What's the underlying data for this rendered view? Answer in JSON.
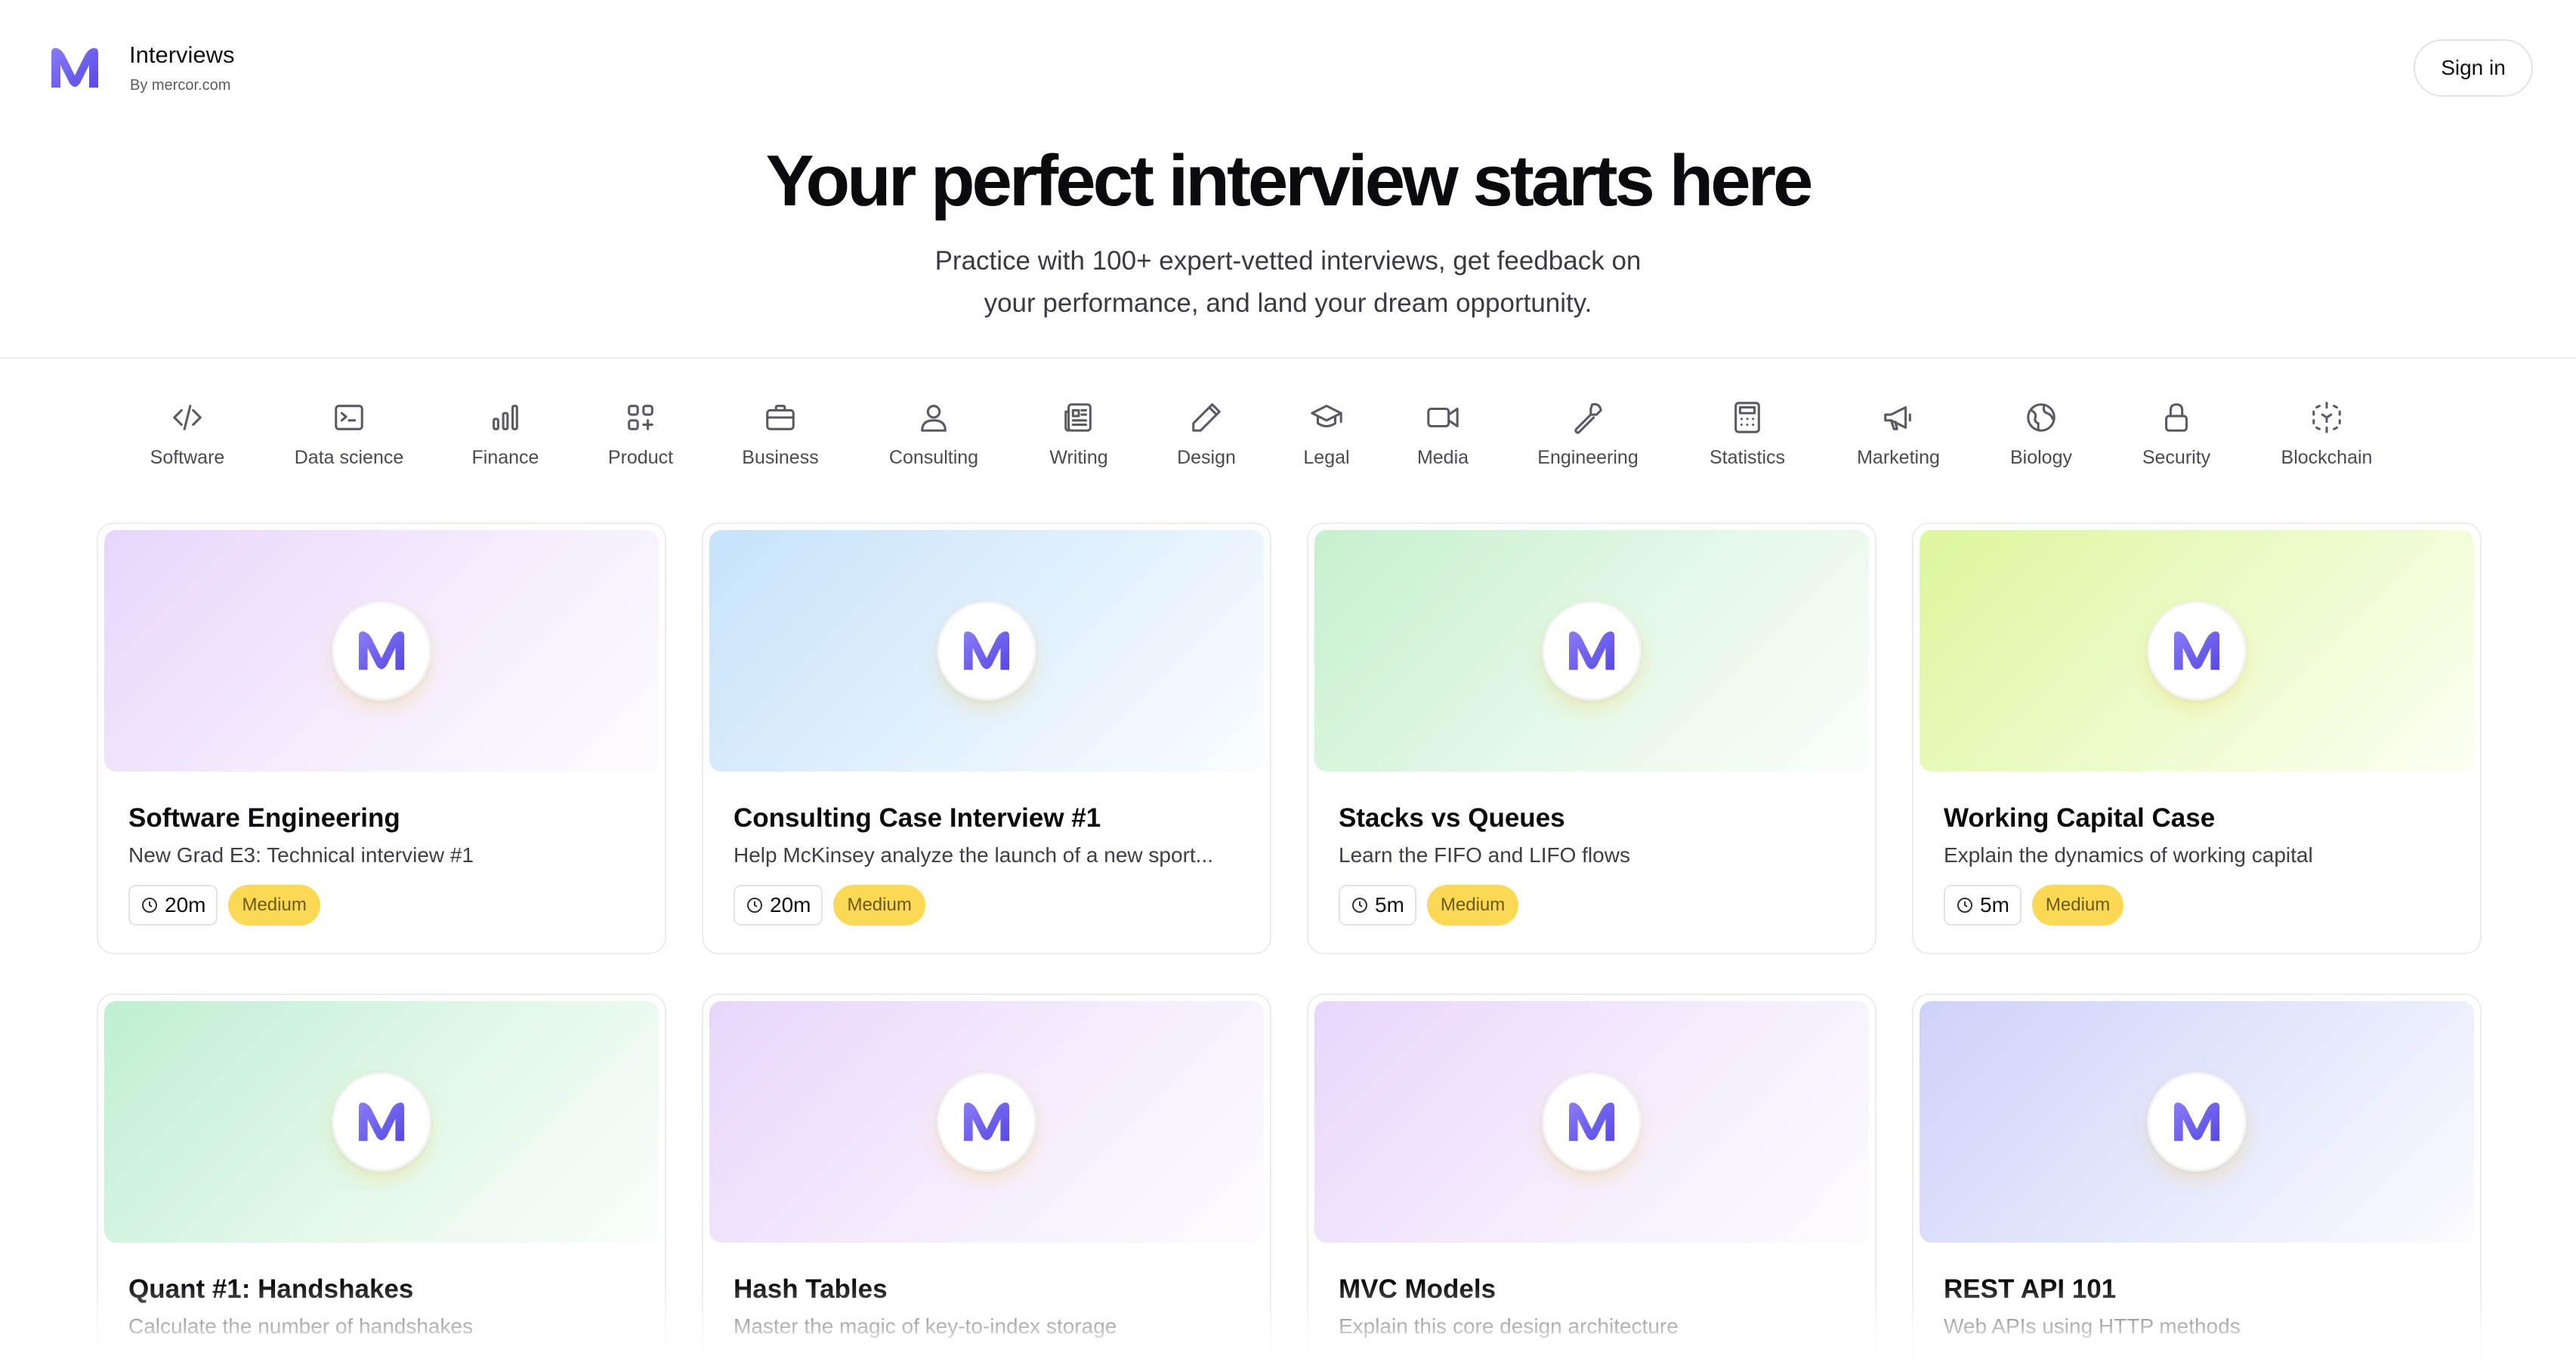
{
  "header": {
    "brand_title": "Interviews",
    "brand_sub": "By mercor.com",
    "sign_in": "Sign in",
    "logo_icon": "mercor-m-logo-icon",
    "accent": "#6d5ff0"
  },
  "hero": {
    "title": "Your perfect interview starts here",
    "subtitle_line1": "Practice with 100+ expert-vetted interviews, get feedback on",
    "subtitle_line2": "your performance, and land your dream opportunity."
  },
  "categories": [
    {
      "label": "Software",
      "icon": "code-icon"
    },
    {
      "label": "Data science",
      "icon": "terminal-icon"
    },
    {
      "label": "Finance",
      "icon": "bar-chart-icon"
    },
    {
      "label": "Product",
      "icon": "grid-plus-icon"
    },
    {
      "label": "Business",
      "icon": "briefcase-icon"
    },
    {
      "label": "Consulting",
      "icon": "person-icon"
    },
    {
      "label": "Writing",
      "icon": "newspaper-icon"
    },
    {
      "label": "Design",
      "icon": "pencil-icon"
    },
    {
      "label": "Legal",
      "icon": "graduation-cap-icon"
    },
    {
      "label": "Media",
      "icon": "video-icon"
    },
    {
      "label": "Engineering",
      "icon": "wrench-icon"
    },
    {
      "label": "Statistics",
      "icon": "calculator-icon"
    },
    {
      "label": "Marketing",
      "icon": "megaphone-icon"
    },
    {
      "label": "Biology",
      "icon": "globe-icon"
    },
    {
      "label": "Security",
      "icon": "lock-icon"
    },
    {
      "label": "Blockchain",
      "icon": "blockchain-icon"
    }
  ],
  "cards": [
    {
      "title": "Software Engineering",
      "desc": "New Grad E3: Technical interview #1",
      "time": "20m",
      "difficulty": "Medium",
      "theme": "purple"
    },
    {
      "title": "Consulting Case Interview #1",
      "desc": "Help McKinsey analyze the launch of a new sport...",
      "time": "20m",
      "difficulty": "Medium",
      "theme": "blue"
    },
    {
      "title": "Stacks vs Queues",
      "desc": "Learn the FIFO and LIFO flows",
      "time": "5m",
      "difficulty": "Medium",
      "theme": "green"
    },
    {
      "title": "Working Capital Case",
      "desc": "Explain the dynamics of working capital",
      "time": "5m",
      "difficulty": "Medium",
      "theme": "lime"
    },
    {
      "title": "Quant #1: Handshakes",
      "desc": "Calculate the number of handshakes",
      "time": "",
      "difficulty": "",
      "theme": "mint"
    },
    {
      "title": "Hash Tables",
      "desc": "Master the magic of key-to-index storage",
      "time": "",
      "difficulty": "",
      "theme": "purple"
    },
    {
      "title": "MVC Models",
      "desc": "Explain this core design architecture",
      "time": "",
      "difficulty": "",
      "theme": "purple"
    },
    {
      "title": "REST API 101",
      "desc": "Web APIs using HTTP methods",
      "time": "",
      "difficulty": "",
      "theme": "indigo"
    }
  ]
}
